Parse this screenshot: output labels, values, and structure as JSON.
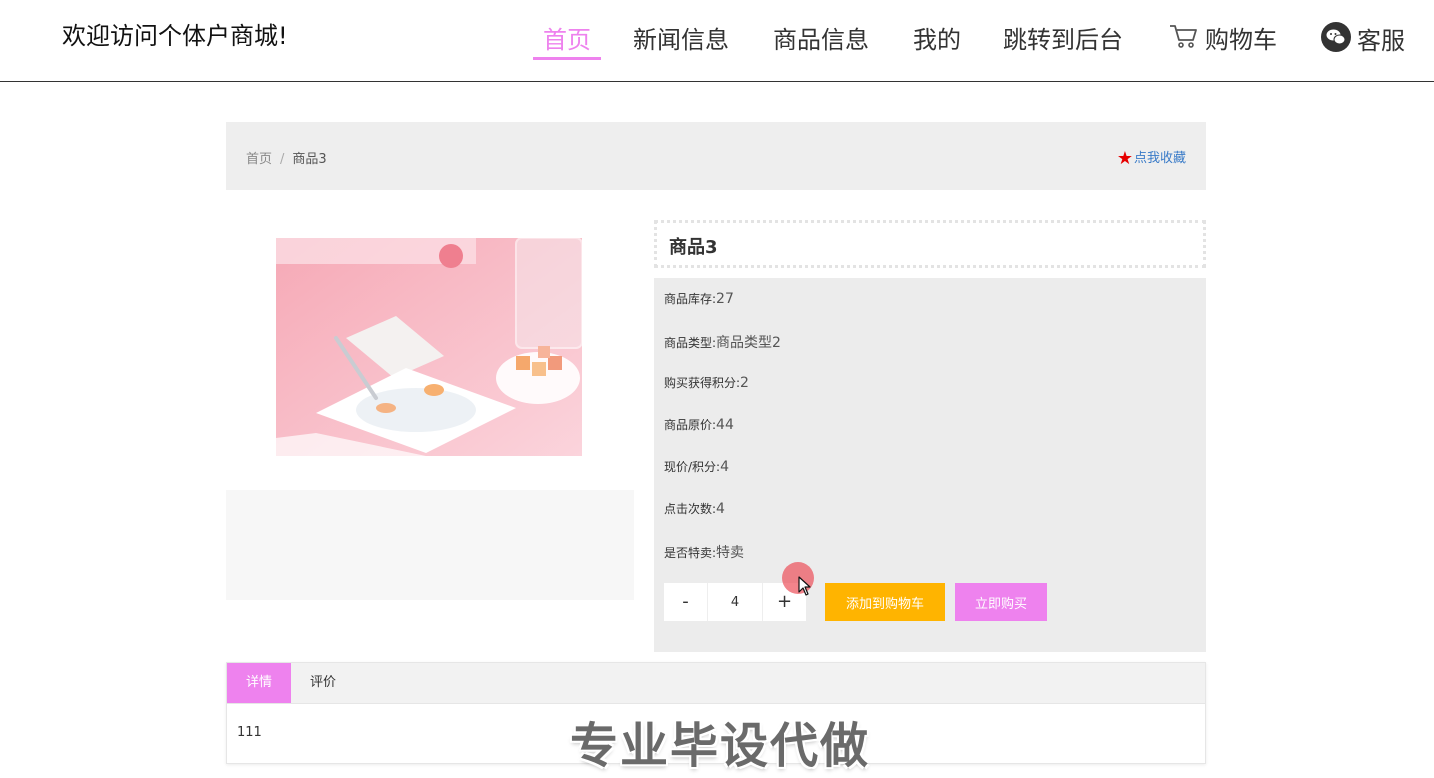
{
  "header": {
    "site_title": "欢迎访问个体户商城!",
    "nav": [
      {
        "label": "首页",
        "active": true
      },
      {
        "label": "新闻信息"
      },
      {
        "label": "商品信息"
      },
      {
        "label": "我的"
      },
      {
        "label": "跳转到后台"
      },
      {
        "label": "购物车",
        "icon": "cart-icon"
      },
      {
        "label": "客服",
        "icon": "wechat-icon"
      }
    ],
    "accent_color": "#ee82ee"
  },
  "breadcrumb": {
    "home": "首页",
    "separator": "/",
    "current": "商品3",
    "favorite_label": "点我收藏",
    "favorite_icon": "star-icon"
  },
  "product": {
    "name": "商品3",
    "image_icon": "product-photo",
    "fields": [
      {
        "label": "商品库存:",
        "value": "27"
      },
      {
        "label": "商品类型:",
        "value": "商品类型2"
      },
      {
        "label": "购买获得积分:",
        "value": "2"
      },
      {
        "label": "商品原价:",
        "value": "44"
      },
      {
        "label": "现价/积分:",
        "value": "4"
      },
      {
        "label": "点击次数:",
        "value": "4"
      },
      {
        "label": "是否特卖:",
        "value": "特卖"
      }
    ],
    "quantity": {
      "minus": "-",
      "value": "4",
      "plus": "+"
    },
    "add_to_cart_label": "添加到购物车",
    "buy_now_label": "立即购买",
    "add_to_cart_color": "#ffb400",
    "buy_now_color": "#ee82ee"
  },
  "tabs": {
    "items": [
      {
        "label": "详情",
        "active": true
      },
      {
        "label": "评价"
      }
    ],
    "content": "111"
  },
  "watermark": "专业毕设代做"
}
